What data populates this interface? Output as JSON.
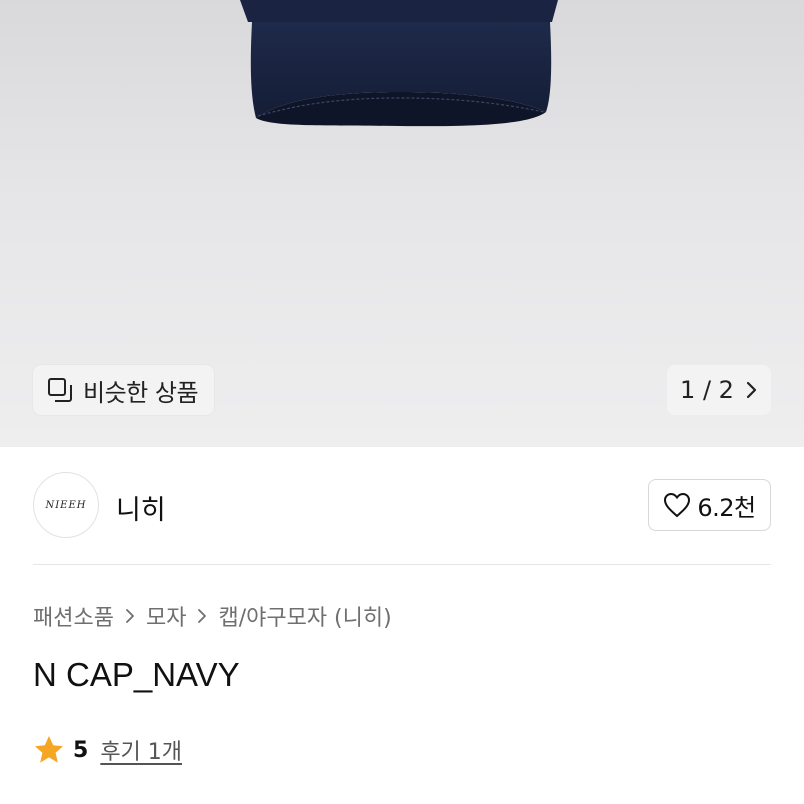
{
  "gallery": {
    "similar_label": "비슷한 상품",
    "pager_label": "1 / 2"
  },
  "seller": {
    "logo_text": "NIEEH",
    "name": "니히",
    "like_count": "6.2천"
  },
  "breadcrumb": {
    "items": [
      "패션소품",
      "모자",
      "캡/야구모자 (니히)"
    ]
  },
  "product": {
    "title": "N CAP_NAVY"
  },
  "rating": {
    "score": "5",
    "reviews_label": "후기 1개"
  },
  "colors": {
    "star": "#f5a623",
    "cap": "#1c2745"
  }
}
